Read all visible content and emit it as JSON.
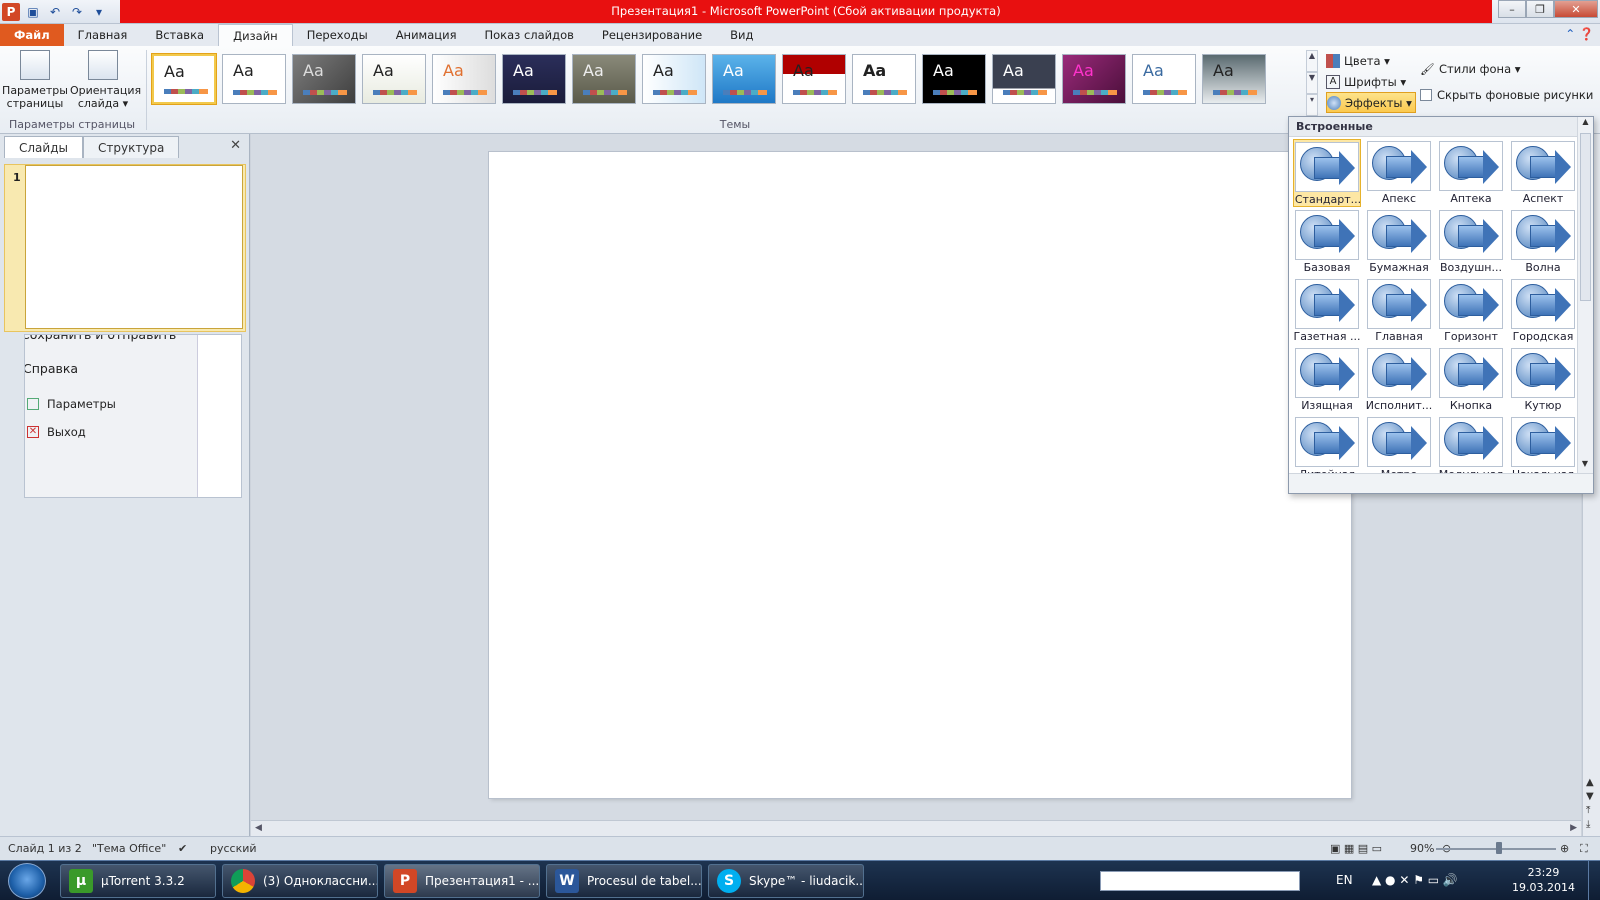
{
  "window": {
    "title": "Презентация1  -  Microsoft PowerPoint (Сбой активации продукта)"
  },
  "tabs": [
    {
      "label": "Файл"
    },
    {
      "label": "Главная"
    },
    {
      "label": "Вставка"
    },
    {
      "label": "Дизайн"
    },
    {
      "label": "Переходы"
    },
    {
      "label": "Анимация"
    },
    {
      "label": "Показ слайдов"
    },
    {
      "label": "Рецензирование"
    },
    {
      "label": "Вид"
    }
  ],
  "ribbon": {
    "page_setup": {
      "params_label": "Параметры страницы",
      "orientation_label": "Ориентация слайда ▾",
      "group_label": "Параметры страницы"
    },
    "themes_group_label": "Темы",
    "theme_samples": [
      "Aa",
      "Aa",
      "Aa",
      "Aa",
      "Aa",
      "Aa",
      "Aa",
      "Aa",
      "Aa",
      "Aa",
      "Aa",
      "Aa",
      "Aa",
      "Aa",
      "Aa",
      "Aa"
    ],
    "colors_label": "Цвета ▾",
    "fonts_label": "Шрифты ▾",
    "effects_label": "Эффекты ▾",
    "bg_styles_label": "Стили фона ▾",
    "hide_bg_label": "Скрыть фоновые рисунки"
  },
  "effects_dropdown": {
    "header": "Встроенные",
    "items": [
      {
        "label": "Стандарт..."
      },
      {
        "label": "Апекс"
      },
      {
        "label": "Аптека"
      },
      {
        "label": "Аспект"
      },
      {
        "label": "Базовая"
      },
      {
        "label": "Бумажная"
      },
      {
        "label": "Воздушн..."
      },
      {
        "label": "Волна"
      },
      {
        "label": "Газетная ..."
      },
      {
        "label": "Главная"
      },
      {
        "label": "Горизонт"
      },
      {
        "label": "Городская"
      },
      {
        "label": "Изящная"
      },
      {
        "label": "Исполнит..."
      },
      {
        "label": "Кнопка"
      },
      {
        "label": "Кутюр"
      },
      {
        "label": "Литейная"
      },
      {
        "label": "Метро"
      },
      {
        "label": "Модульная"
      },
      {
        "label": "Начальная"
      }
    ]
  },
  "left_panel": {
    "tab_slides": "Слайды",
    "tab_outline": "Структура",
    "close": "✕",
    "slide_number": "1",
    "ghost_menu": {
      "save_send": "Сохранить и отправить",
      "help": "Справка",
      "options": "Параметры",
      "exit": "Выход"
    }
  },
  "statusbar": {
    "slide_info": "Слайд 1 из 2",
    "theme": "\"Тема Office\"",
    "language": "русский",
    "zoom": "90%"
  },
  "taskbar": {
    "buttons": [
      {
        "label": "µTorrent 3.3.2"
      },
      {
        "label": "(3) Одноклассни..."
      },
      {
        "label": "Презентация1 - ..."
      },
      {
        "label": "Procesul de tabel..."
      },
      {
        "label": "Skype™ - liudacik..."
      }
    ],
    "lang": "EN",
    "time": "23:29",
    "date": "19.03.2014"
  }
}
